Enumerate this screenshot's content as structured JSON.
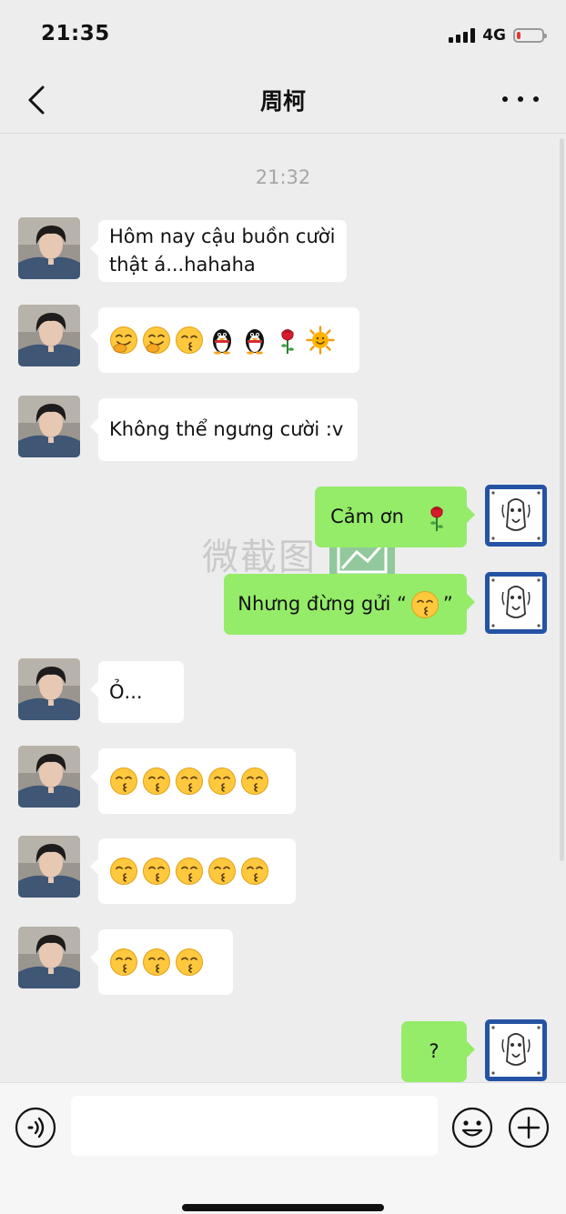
{
  "status_bar": {
    "time": "21:35",
    "network": "4G",
    "signal_icon": "signal-bars-icon",
    "battery_icon": "battery-low-icon",
    "battery_color": "#e53935"
  },
  "nav": {
    "title": "周柯",
    "back_icon": "chevron-left-icon",
    "more_icon": "ellipsis-icon"
  },
  "chat": {
    "timestamp": "21:32",
    "watermark": "微截图",
    "messages": [
      {
        "side": "left",
        "text": "Hôm nay cậu buồn cười\nthật á...hahaha"
      },
      {
        "side": "left",
        "emojis": [
          "grinning-face-with-hand-emoji",
          "grinning-face-with-hand-emoji",
          "kissing-smile-emoji",
          "penguin-emoji",
          "penguin-emoji",
          "rose-emoji",
          "sun-emoji"
        ]
      },
      {
        "side": "left",
        "text": "Không thể ngưng cười :v"
      },
      {
        "side": "right",
        "text": "Cảm ơn",
        "emojis": [
          "rose-emoji"
        ]
      },
      {
        "side": "right",
        "text": "Nhưng đừng gửi “",
        "emojis": [
          "kissing-smile-emoji"
        ],
        "suffix": "”"
      },
      {
        "side": "left",
        "text": "Ỏ..."
      },
      {
        "side": "left",
        "emojis": [
          "kissing-smile-emoji",
          "kissing-smile-emoji",
          "kissing-smile-emoji",
          "kissing-smile-emoji",
          "kissing-smile-emoji"
        ]
      },
      {
        "side": "left",
        "emojis": [
          "kissing-smile-emoji",
          "kissing-smile-emoji",
          "kissing-smile-emoji",
          "kissing-smile-emoji",
          "kissing-smile-emoji"
        ]
      },
      {
        "side": "left",
        "emojis": [
          "kissing-smile-emoji",
          "kissing-smile-emoji",
          "kissing-smile-emoji"
        ]
      },
      {
        "side": "right",
        "text": "?"
      }
    ]
  },
  "input_bar": {
    "voice_icon": "voice-input-icon",
    "emoji_icon": "emoji-face-icon",
    "plus_icon": "plus-circle-icon",
    "input_value": "",
    "input_placeholder": ""
  },
  "colors": {
    "background": "#ededed",
    "outgoing_bubble": "#95ec69",
    "incoming_bubble": "#ffffff"
  }
}
